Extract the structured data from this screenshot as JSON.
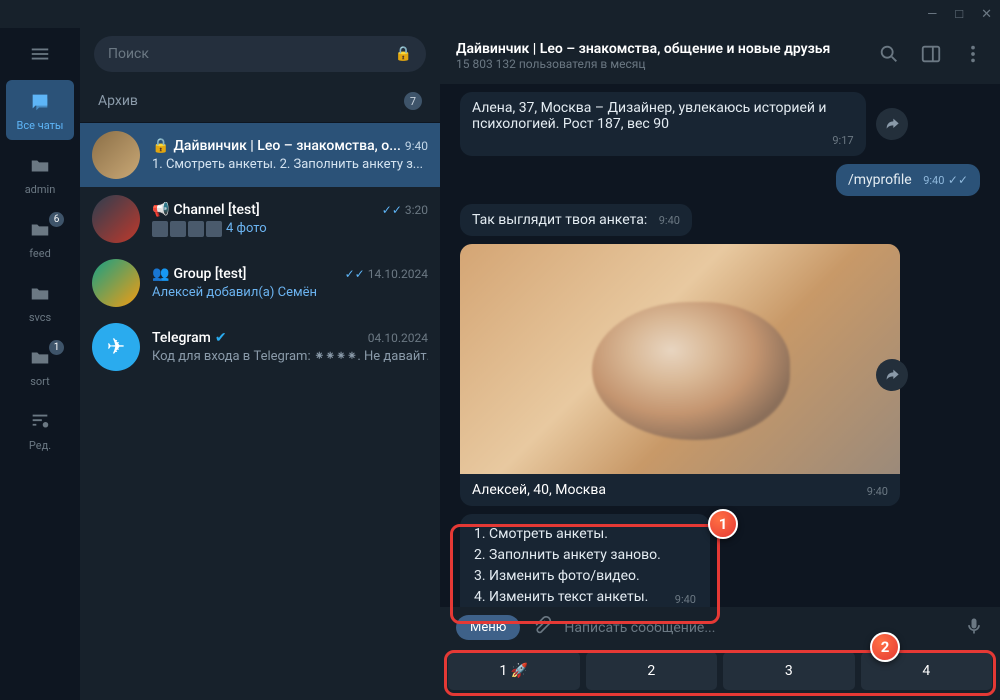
{
  "titlebar": {
    "min": "—",
    "max": "□",
    "close": "✕"
  },
  "rail": {
    "items": [
      {
        "label": "Все чаты",
        "icon": "chat"
      },
      {
        "label": "admin",
        "icon": "folder"
      },
      {
        "label": "feed",
        "icon": "folder",
        "badge": "6"
      },
      {
        "label": "svcs",
        "icon": "folder"
      },
      {
        "label": "sort",
        "icon": "folder",
        "badge": "1"
      },
      {
        "label": "Ред.",
        "icon": "edit"
      }
    ]
  },
  "search": {
    "placeholder": "Поиск"
  },
  "archive": {
    "label": "Архив",
    "count": "7"
  },
  "chats": [
    {
      "name": "Дайвинчик | Leo – знакомства, о...",
      "time": "9:40",
      "preview": "1. Смотреть анкеты. 2. Заполнить анкету з...",
      "sel": true,
      "icon": "🔒"
    },
    {
      "name": "Channel [test]",
      "time": "3:20",
      "preview": "4 фото",
      "checks": true,
      "thumbs": true,
      "icon": "📢"
    },
    {
      "name": "Group [test]",
      "time": "14.10.2024",
      "preview": "Алексей добавил(а) Семён",
      "checks": true,
      "icon": "👥"
    },
    {
      "name": "Telegram",
      "time": "04.10.2024",
      "preview": "Код для входа в Telegram: ⁕⁕⁕⁕. Не давайт...",
      "verified": true
    }
  ],
  "header": {
    "title": "Дайвинчик | Leo – знакомства, общение и новые друзья",
    "sub": "15 803 132 пользователя в месяц"
  },
  "messages": {
    "first": {
      "text": "Алена, 37, Москва – Дизайнер, увлекаюсь историей и психологией. Рост 187, вес 90",
      "time": "9:17"
    },
    "out": {
      "text": "/myprofile",
      "time": "9:40"
    },
    "intro": {
      "text": "Так выглядит твоя анкета:",
      "time": "9:40"
    },
    "photo": {
      "caption": "Алексей, 40, Москва",
      "time": "9:40"
    },
    "menu": {
      "l1": "1. Смотреть анкеты.",
      "l2": "2. Заполнить анкету заново.",
      "l3": "3. Изменить фото/видео.",
      "l4": "4. Изменить текст анкеты.",
      "time": "9:40"
    }
  },
  "input": {
    "menu": "Меню",
    "placeholder": "Написать сообщение..."
  },
  "keyboard": [
    "1 🚀",
    "2",
    "3",
    "4"
  ],
  "annotations": {
    "n1": "1",
    "n2": "2"
  }
}
